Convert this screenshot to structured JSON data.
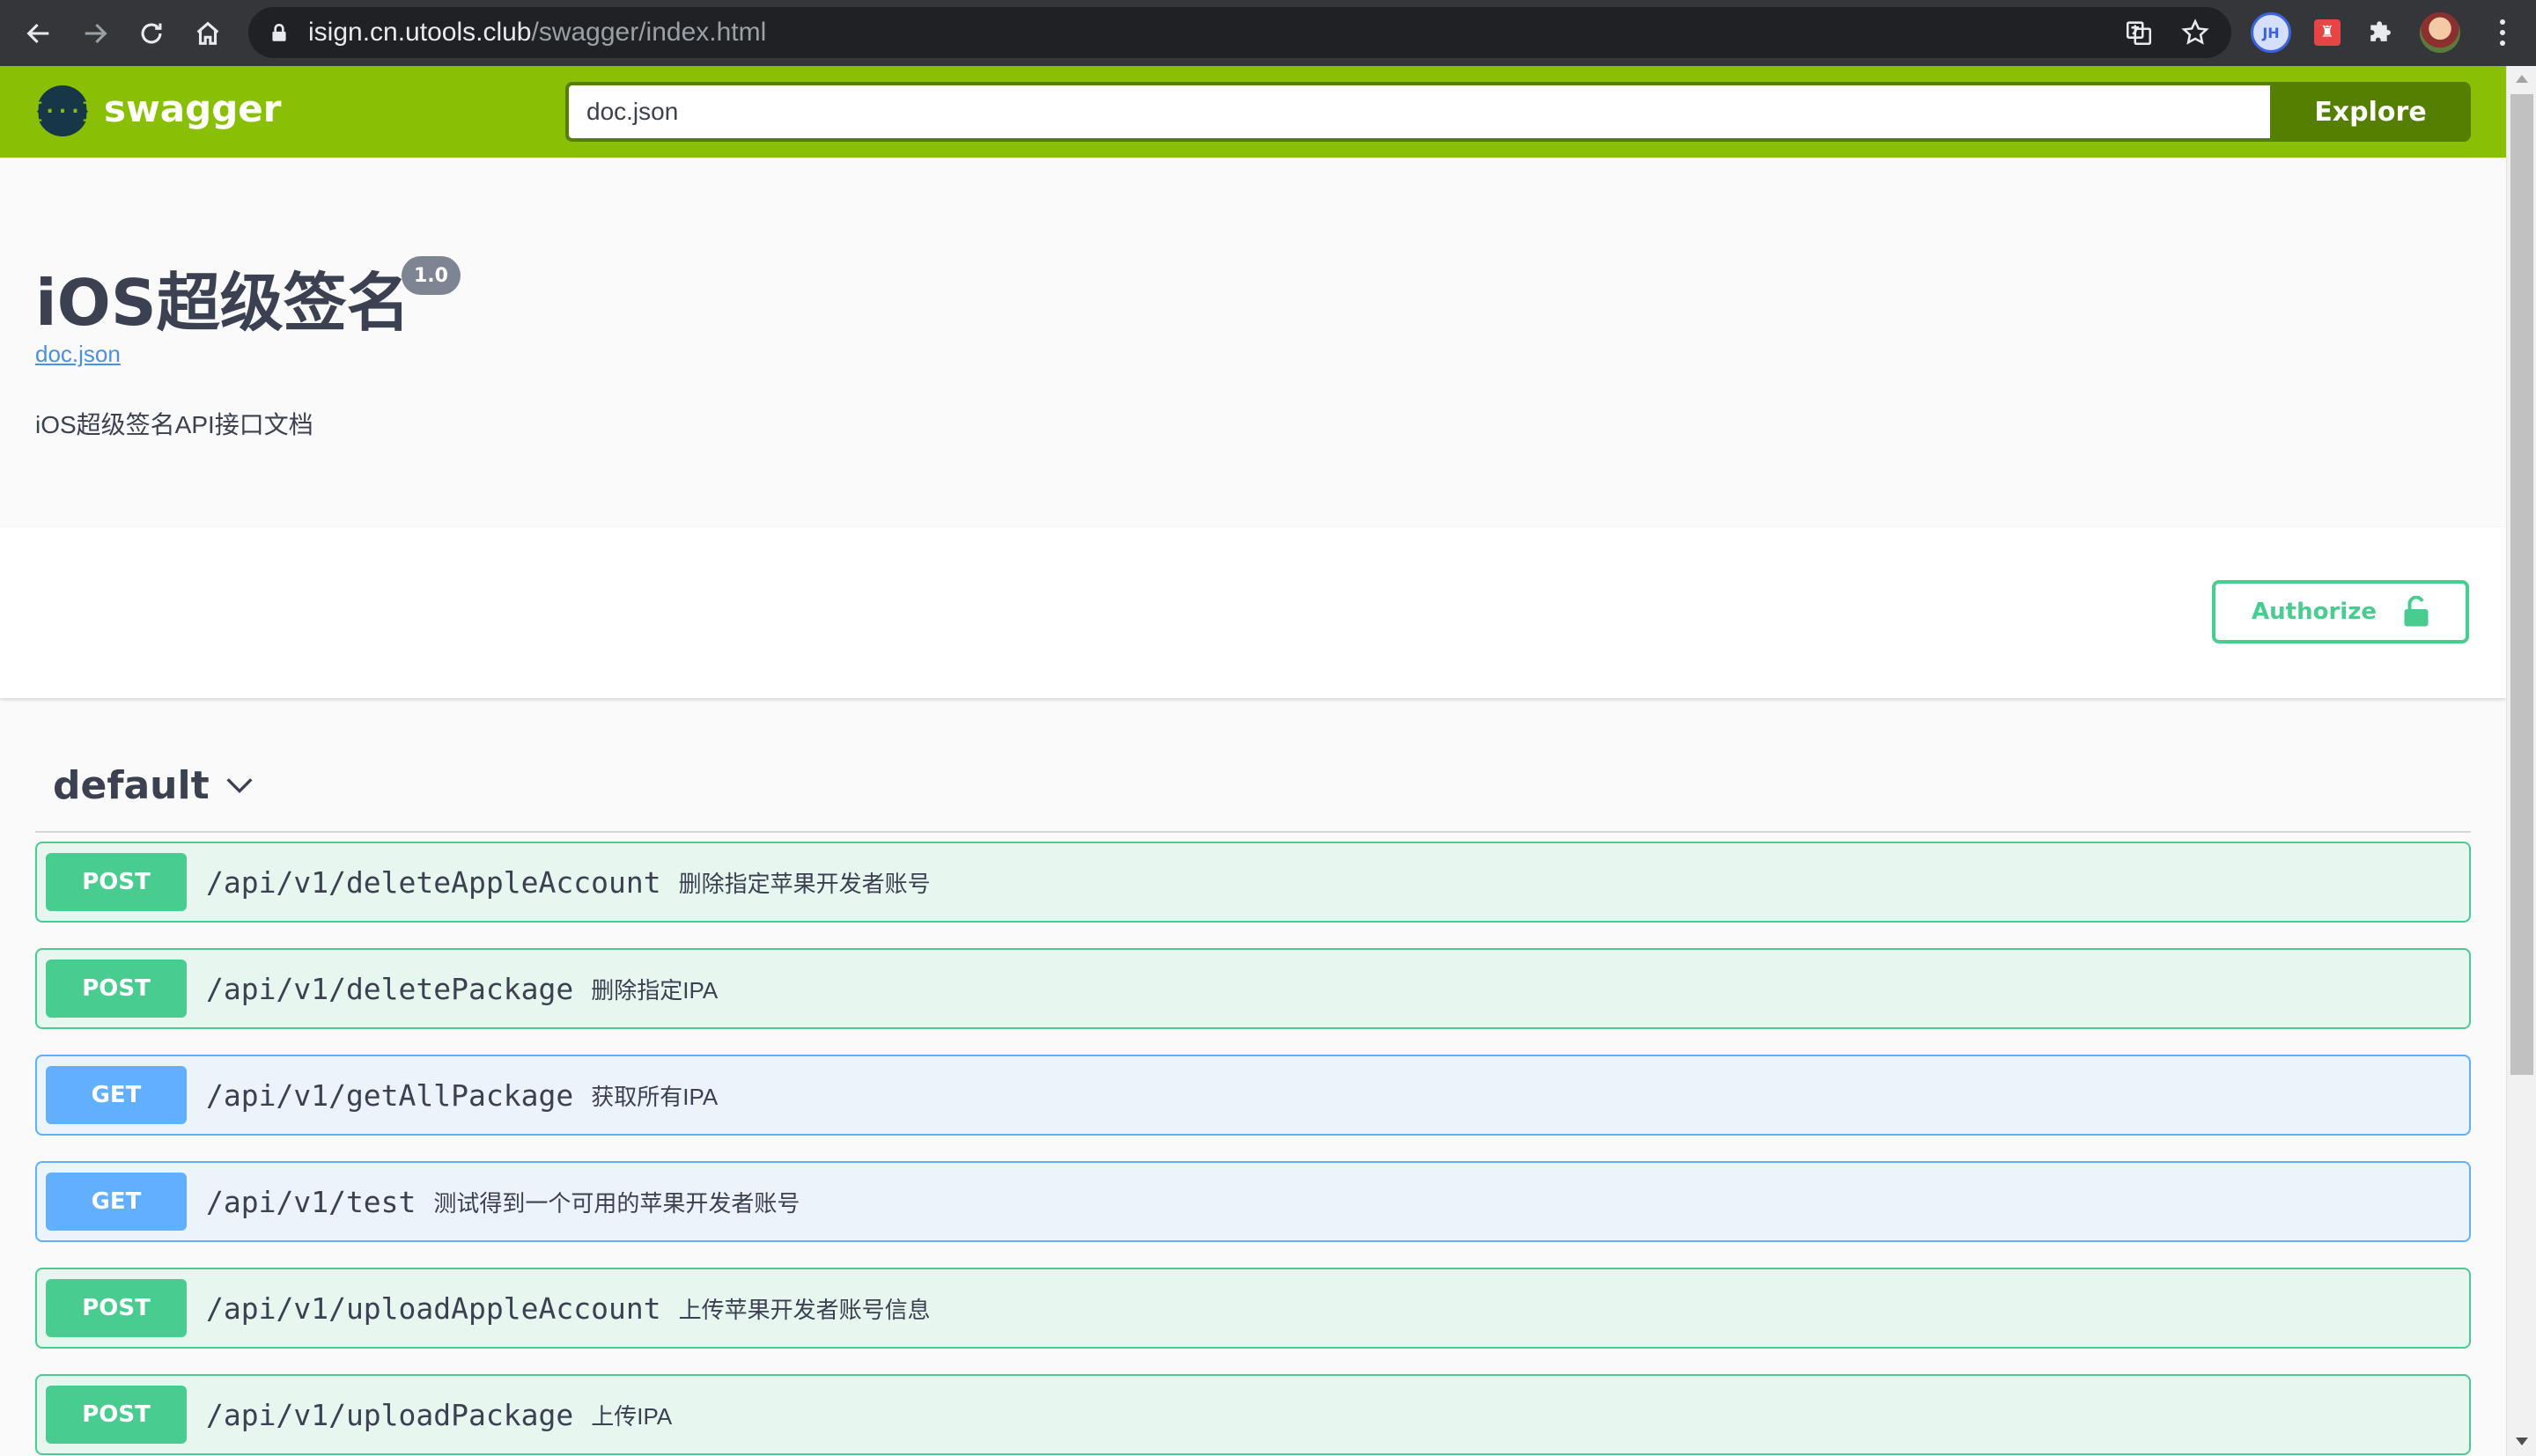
{
  "browser": {
    "url_host": "isign.cn.utools.club",
    "url_path": "/swagger/index.html",
    "ext_jh": "JH"
  },
  "topbar": {
    "logo_text": "swagger",
    "logo_symbol": "{···}",
    "spec_url": "doc.json",
    "explore_label": "Explore",
    "brand_color": "#89bf04"
  },
  "info": {
    "title": "iOS超级签名",
    "version": "1.0",
    "spec_link": "doc.json",
    "description": "iOS超级签名API接口文档"
  },
  "auth": {
    "label": "Authorize"
  },
  "tag": {
    "name": "default"
  },
  "operations": [
    {
      "method": "POST",
      "path": "/api/v1/deleteAppleAccount",
      "summary": "删除指定苹果开发者账号"
    },
    {
      "method": "POST",
      "path": "/api/v1/deletePackage",
      "summary": "删除指定IPA"
    },
    {
      "method": "GET",
      "path": "/api/v1/getAllPackage",
      "summary": "获取所有IPA"
    },
    {
      "method": "GET",
      "path": "/api/v1/test",
      "summary": "测试得到一个可用的苹果开发者账号"
    },
    {
      "method": "POST",
      "path": "/api/v1/uploadAppleAccount",
      "summary": "上传苹果开发者账号信息"
    },
    {
      "method": "POST",
      "path": "/api/v1/uploadPackage",
      "summary": "上传IPA"
    }
  ],
  "colors": {
    "post": "#49cc90",
    "get": "#61affe",
    "text": "#3b4151"
  }
}
